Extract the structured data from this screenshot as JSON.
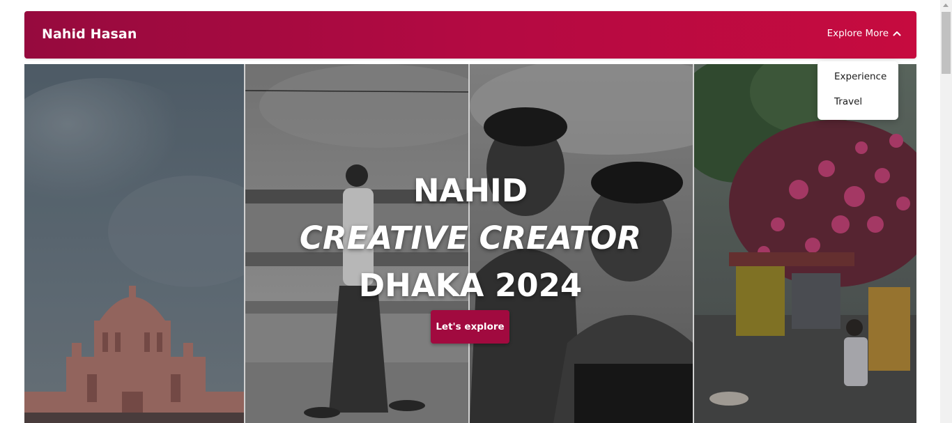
{
  "navbar": {
    "brand": "Nahid Hasan",
    "explore_label": "Explore More",
    "accent_from": "#960a3e",
    "accent_to": "#c60b3f"
  },
  "dropdown": {
    "items": [
      {
        "label": "Experience"
      },
      {
        "label": "Travel"
      }
    ]
  },
  "hero": {
    "line1": "NAHID",
    "line2": "CREATIVE CREATOR",
    "line3": "DHAKA 2024",
    "cta_label": "Let's explore",
    "panels": [
      {
        "subject": "pink palace dome under cloudy sky"
      },
      {
        "subject": "man walking on bridge by river (black and white)"
      },
      {
        "subject": "two smiling boys (black and white)"
      },
      {
        "subject": "street stall under pink bougainvillea"
      }
    ]
  },
  "icons": {
    "explore_toggle": "chevron-up-icon"
  }
}
